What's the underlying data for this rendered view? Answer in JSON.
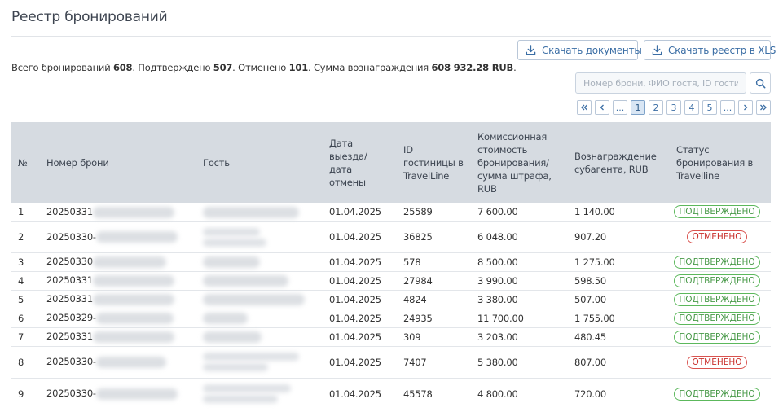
{
  "page": {
    "title": "Реестр бронирований"
  },
  "toolbar": {
    "download_docs": "Скачать документы",
    "download_xls": "Скачать реестр в XLS"
  },
  "summary": {
    "total_label": "Всего бронирований",
    "total": "608",
    "confirmed_label": "Подтверждено",
    "confirmed": "507",
    "cancelled_label": "Отменено",
    "cancelled": "101",
    "reward_label": "Сумма вознаграждения",
    "reward": "608 932.28 RUB"
  },
  "search": {
    "placeholder": "Номер брони, ФИО гостя, ID гостиницы"
  },
  "pagination": {
    "first": "«",
    "prev": "‹",
    "ellipsis_left": "...",
    "pages": [
      "1",
      "2",
      "3",
      "4",
      "5"
    ],
    "current": "1",
    "ellipsis_right": "...",
    "next": "›",
    "last": "»"
  },
  "table": {
    "columns": [
      "№",
      "Номер брони",
      "Гость",
      "Дата выезда/ дата отмены",
      "ID гостиницы в TravelLine",
      "Комиссионная стоимость бронирования/ сумма штрафа, RUB",
      "Вознаграждение субагента, RUB",
      "Статус бронирования в Travelline"
    ],
    "rows": [
      {
        "n": "1",
        "booking": "20250331",
        "date": "01.04.2025",
        "hotel_id": "25589",
        "commission": "7 600.00",
        "reward": "1 140.00",
        "status": "ПОДТВЕРЖДЕНО",
        "status_kind": "ok"
      },
      {
        "n": "2",
        "booking": "20250330-",
        "date": "01.04.2025",
        "hotel_id": "36825",
        "commission": "6 048.00",
        "reward": "907.20",
        "status": "ОТМЕНЕНО",
        "status_kind": "cancel"
      },
      {
        "n": "3",
        "booking": "20250330",
        "date": "01.04.2025",
        "hotel_id": "578",
        "commission": "8 500.00",
        "reward": "1 275.00",
        "status": "ПОДТВЕРЖДЕНО",
        "status_kind": "ok"
      },
      {
        "n": "4",
        "booking": "20250331",
        "date": "01.04.2025",
        "hotel_id": "27984",
        "commission": "3 990.00",
        "reward": "598.50",
        "status": "ПОДТВЕРЖДЕНО",
        "status_kind": "ok"
      },
      {
        "n": "5",
        "booking": "20250331",
        "date": "01.04.2025",
        "hotel_id": "4824",
        "commission": "3 380.00",
        "reward": "507.00",
        "status": "ПОДТВЕРЖДЕНО",
        "status_kind": "ok"
      },
      {
        "n": "6",
        "booking": "20250329-",
        "date": "01.04.2025",
        "hotel_id": "24935",
        "commission": "11 700.00",
        "reward": "1 755.00",
        "status": "ПОДТВЕРЖДЕНО",
        "status_kind": "ok"
      },
      {
        "n": "7",
        "booking": "20250331",
        "date": "01.04.2025",
        "hotel_id": "309",
        "commission": "3 203.00",
        "reward": "480.45",
        "status": "ПОДТВЕРЖДЕНО",
        "status_kind": "ok"
      },
      {
        "n": "8",
        "booking": "20250330-",
        "date": "01.04.2025",
        "hotel_id": "7407",
        "commission": "5 380.00",
        "reward": "807.00",
        "status": "ОТМЕНЕНО",
        "status_kind": "cancel"
      },
      {
        "n": "9",
        "booking": "20250330-",
        "date": "01.04.2025",
        "hotel_id": "45578",
        "commission": "4 800.00",
        "reward": "720.00",
        "status": "ПОДТВЕРЖДЕНО",
        "status_kind": "ok"
      }
    ]
  },
  "icons": {
    "download": "download-icon",
    "search": "search-icon"
  },
  "colors": {
    "accent": "#3b6ea5",
    "header_bg": "#d6dbe1",
    "status_ok": "#5cb85c",
    "status_cancel": "#d9534f"
  }
}
